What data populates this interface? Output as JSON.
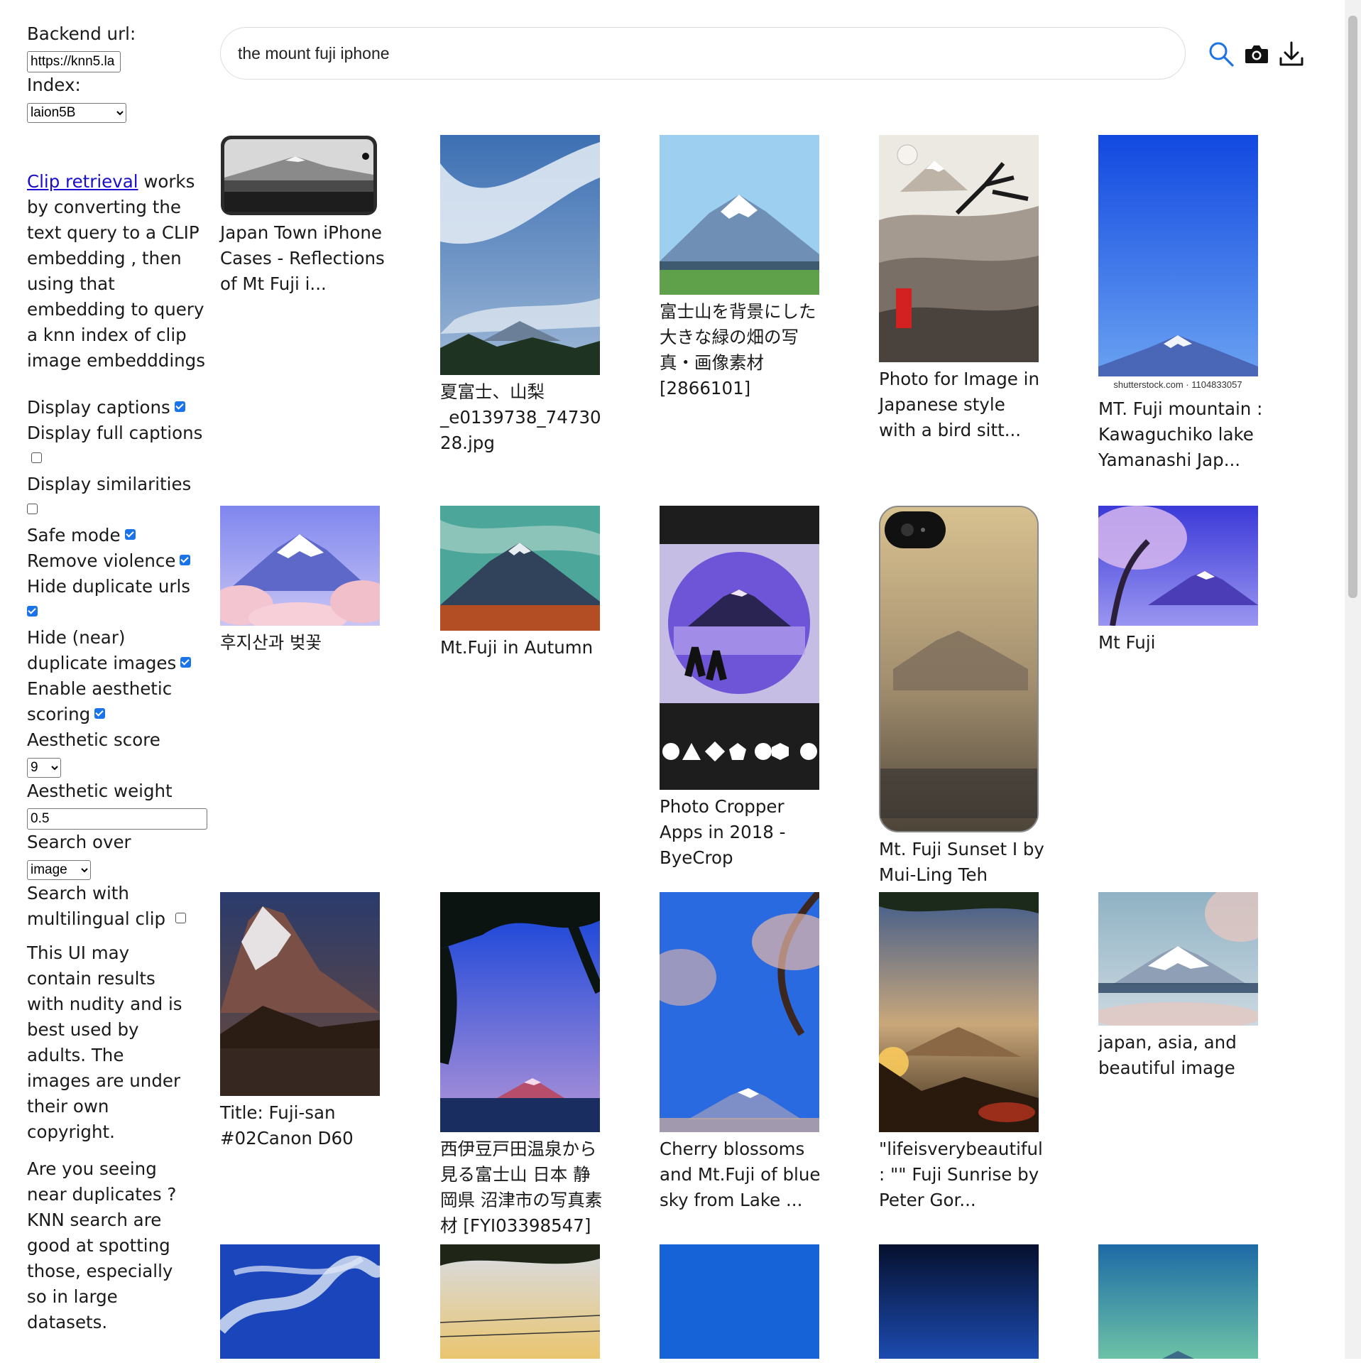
{
  "sidebar": {
    "backend_label": "Backend url:",
    "backend_value": "https://knn5.la",
    "index_label": "Index:",
    "index_value": "laion5B",
    "intro_link": "Clip retrieval",
    "intro_text": " works by converting the text query to a CLIP embedding , then using that embedding to query a knn index of clip image embedddings",
    "opt_display_captions": "Display captions",
    "opt_display_full_captions": "Display full captions",
    "opt_display_similarities": "Display similarities",
    "opt_safe_mode": "Safe mode",
    "opt_remove_violence": "Remove violence",
    "opt_hide_dup_urls": "Hide duplicate urls",
    "opt_hide_dup_images": "Hide (near) duplicate images",
    "opt_aesthetic_scoring": "Enable aesthetic scoring",
    "aesthetic_score_label": "Aesthetic score",
    "aesthetic_score_value": "9",
    "aesthetic_weight_label": "Aesthetic weight",
    "aesthetic_weight_value": "0.5",
    "search_over_label": "Search over",
    "search_over_value": "image",
    "multilingual_label": "Search with multilingual clip",
    "warning_text": "This UI may contain results with nudity and is best used by adults. The images are under their own copyright.",
    "dup_text": "Are you seeing near duplicates ? KNN search are good at spotting those, especially so in large datasets."
  },
  "search": {
    "query": "the mount fuji iphone"
  },
  "icons": [
    "search-icon",
    "camera-icon",
    "download-icon"
  ],
  "results": [
    {
      "caption": "Japan Town iPhone Cases - Reflections of Mt Fuji i..."
    },
    {
      "caption": "夏富士、山梨_e0139738_7473028.jpg"
    },
    {
      "caption": "富士山を背景にした大きな緑の畑の写真・画像素材[2866101]"
    },
    {
      "caption": "Photo for Image in Japanese style with a bird sitt..."
    },
    {
      "caption": "MT. Fuji mountain : Kawaguchiko lake Yamanashi Jap...",
      "watermark": "shutterstock.com · 1104833057"
    },
    {
      "caption": "후지산과 벚꽃"
    },
    {
      "caption": "Mt.Fuji in Autumn"
    },
    {
      "caption": "Photo Cropper Apps in 2018 - ByeCrop"
    },
    {
      "caption": "Mt. Fuji Sunset I by Mui-Ling Teh"
    },
    {
      "caption": "Mt Fuji"
    },
    {
      "caption": "Title: Fuji-san #02Canon D60"
    },
    {
      "caption": "西伊豆戸田温泉から見る富士山 日本 静岡県 沼津市の写真素材 [FYI03398547]"
    },
    {
      "caption": "Cherry blossoms and Mt.Fuji of blue sky from Lake ..."
    },
    {
      "caption": "\"lifeisverybeautiful: \"\" Fuji Sunrise by Peter Gor..."
    },
    {
      "caption": "japan, asia, and beautiful image"
    },
    {
      "caption": ""
    },
    {
      "caption": ""
    },
    {
      "caption": ""
    },
    {
      "caption": ""
    },
    {
      "caption": ""
    }
  ],
  "colors": {
    "link": "#1a0dcc",
    "checkbox": "#1a73e8",
    "search_icon": "#1a73e8"
  }
}
